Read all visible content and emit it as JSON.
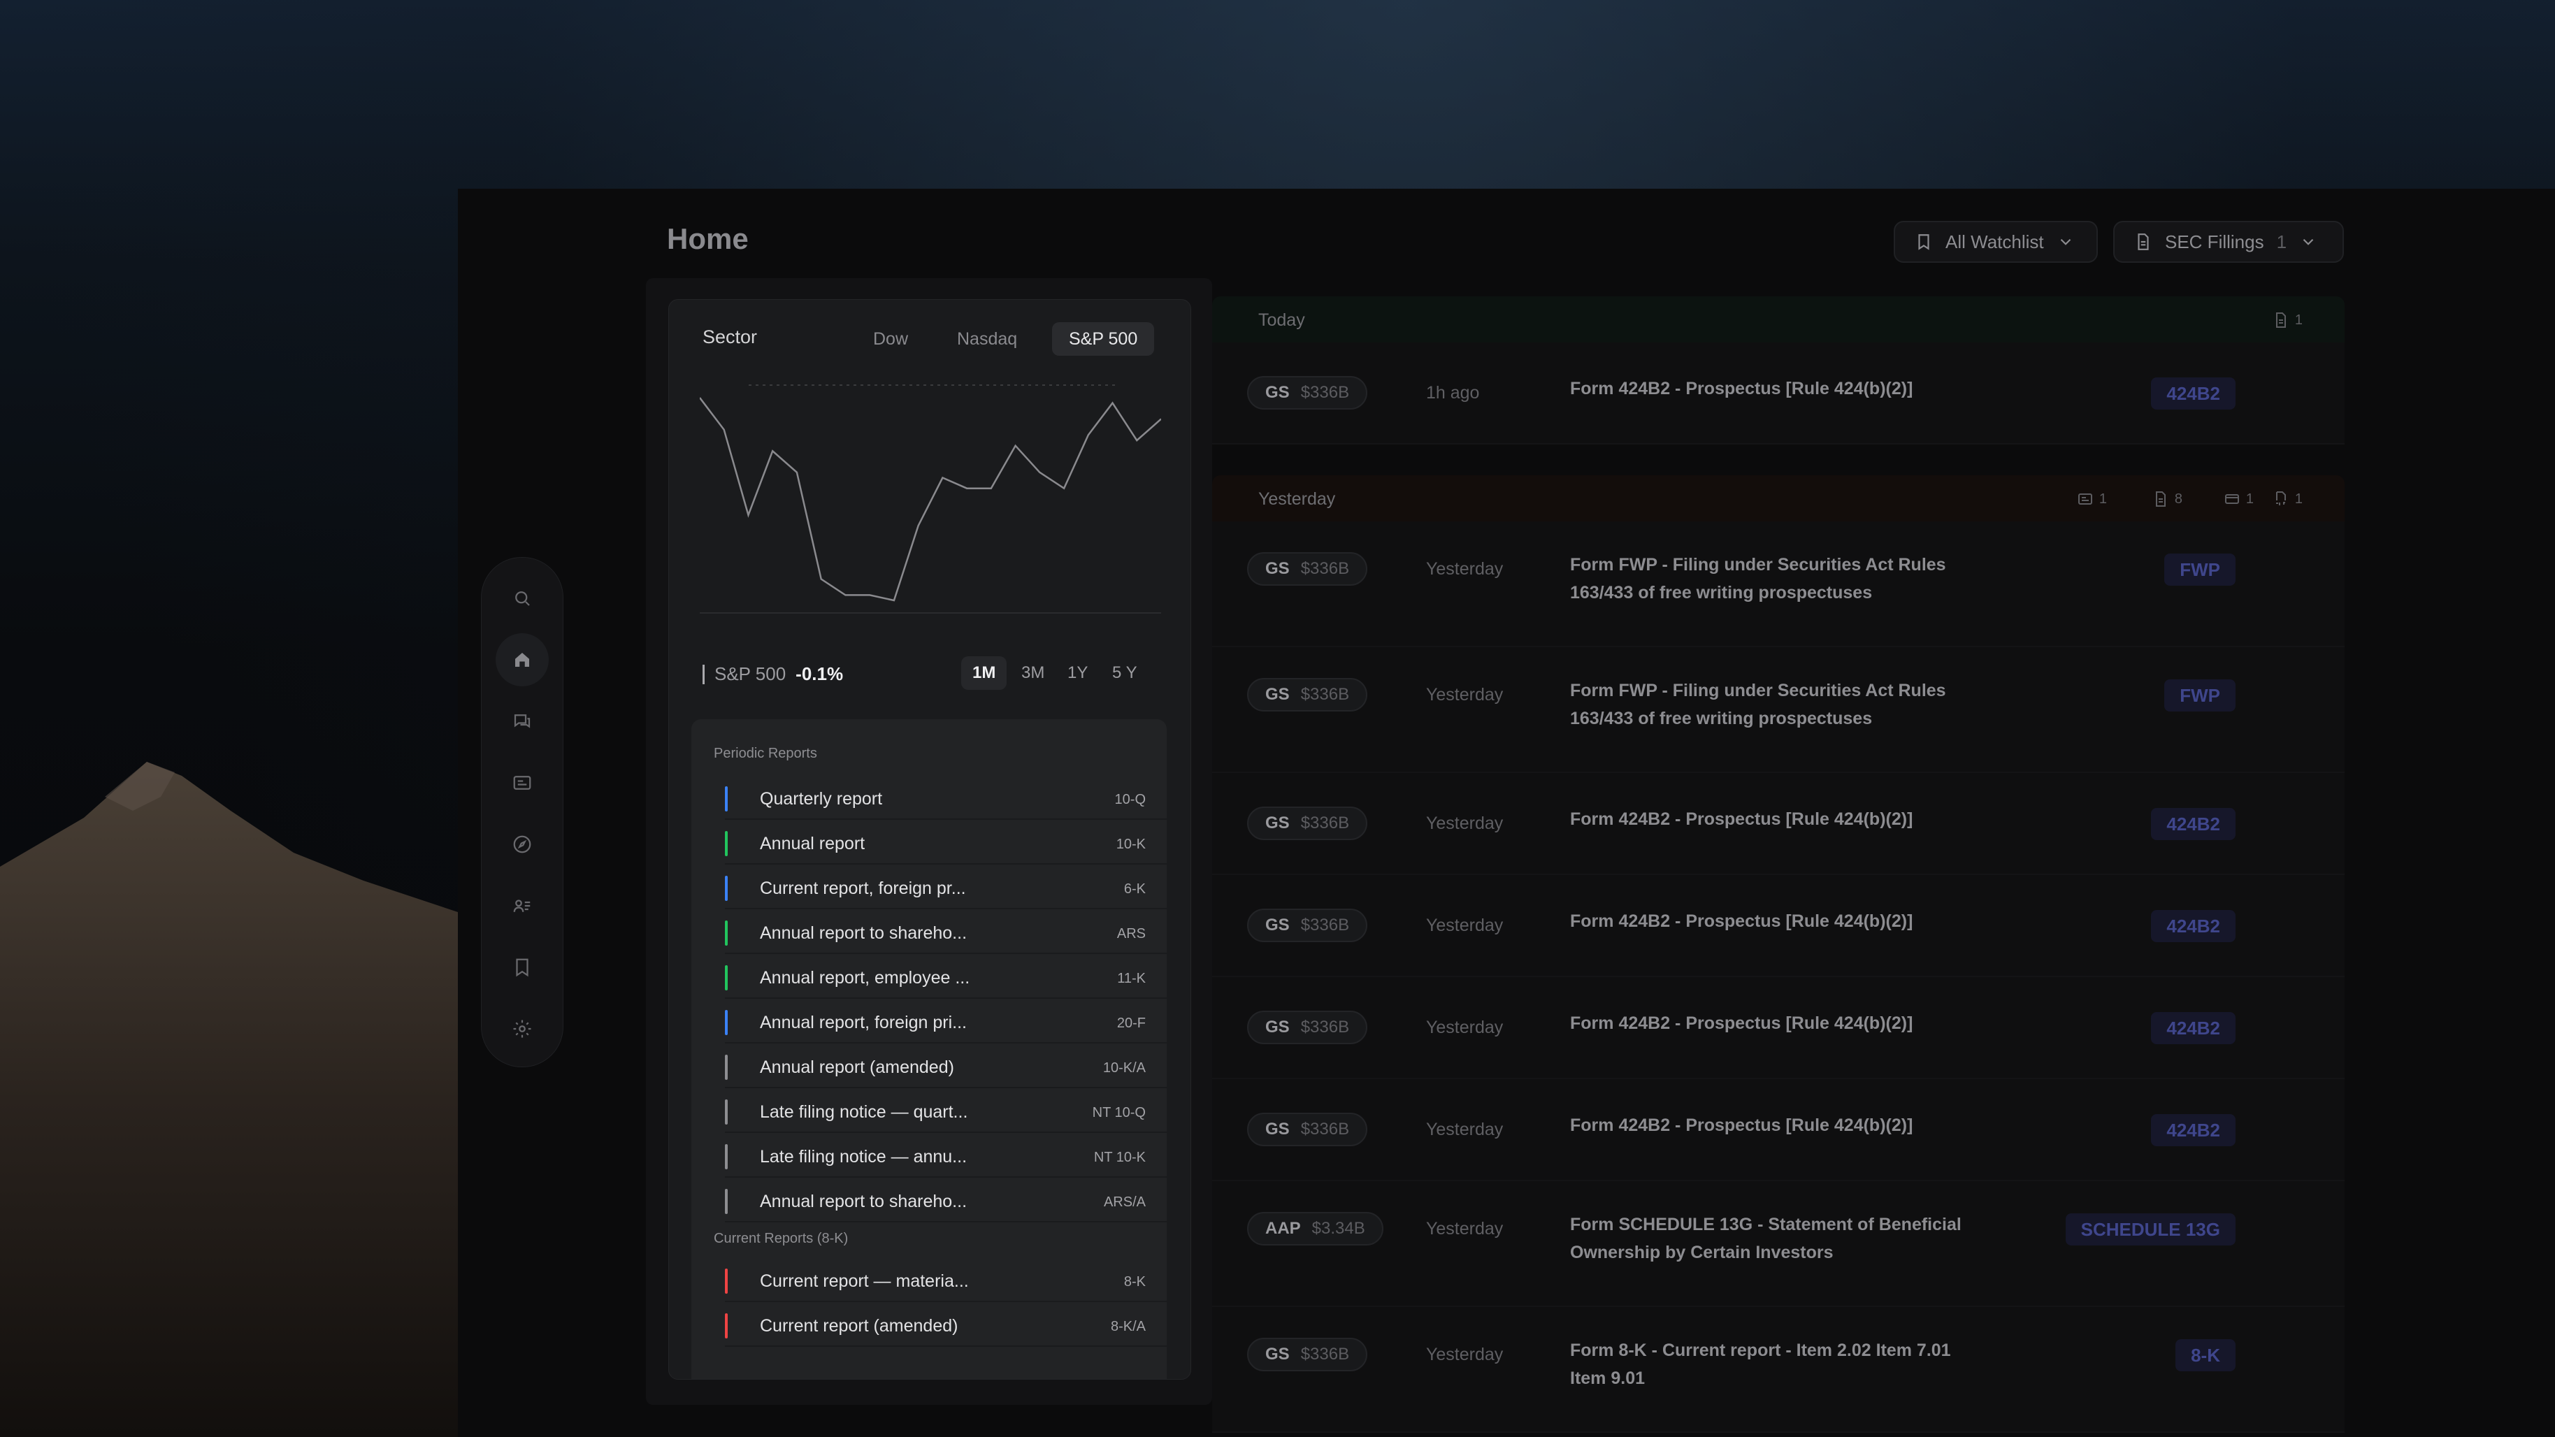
{
  "page": {
    "title": "Home"
  },
  "toolbar": {
    "watchlist_label": "All Watchlist",
    "filings_label": "SEC Fillings",
    "filings_count": "1"
  },
  "sidebar": {
    "icons": [
      "search-icon",
      "home-icon",
      "chat-icon",
      "news-icon",
      "compass-icon",
      "contacts-icon",
      "bookmark-icon",
      "settings-icon"
    ]
  },
  "market": {
    "title": "Sector",
    "tabs": [
      "Dow",
      "Nasdaq",
      "S&P 500"
    ],
    "active_tab": "S&P 500",
    "legend_label": "S&P 500",
    "change": "-0.1%",
    "ranges": [
      "1M",
      "3M",
      "1Y",
      "5 Y"
    ],
    "active_range": "1M"
  },
  "chart_data": {
    "type": "line",
    "title": "",
    "series": [
      {
        "values": [
          62,
          56,
          40,
          52,
          48,
          28,
          25,
          25,
          24,
          38,
          47,
          45,
          45,
          53,
          48,
          45,
          55,
          61,
          54,
          58
        ]
      }
    ],
    "grid": false,
    "legend": "bottom-left"
  },
  "reports": {
    "periodic_label": "Periodic Reports",
    "periodic": [
      {
        "name": "Quarterly report",
        "code": "10-Q",
        "color": "#3b82f6"
      },
      {
        "name": "Annual report",
        "code": "10-K",
        "color": "#22c55e"
      },
      {
        "name": "Current report, foreign pr...",
        "code": "6-K",
        "color": "#3b82f6"
      },
      {
        "name": "Annual report to shareho...",
        "code": "ARS",
        "color": "#22c55e"
      },
      {
        "name": "Annual report, employee ...",
        "code": "11-K",
        "color": "#22c55e"
      },
      {
        "name": "Annual report, foreign pri...",
        "code": "20-F",
        "color": "#3b82f6"
      },
      {
        "name": "Annual report (amended)",
        "code": "10-K/A",
        "color": "#8e8e92"
      },
      {
        "name": "Late filing notice — quart...",
        "code": "NT 10-Q",
        "color": "#8e8e92"
      },
      {
        "name": "Late filing notice — annu...",
        "code": "NT 10-K",
        "color": "#8e8e92"
      },
      {
        "name": "Annual report to shareho...",
        "code": "ARS/A",
        "color": "#8e8e92"
      }
    ],
    "current_label": "Current Reports (8-K)",
    "current": [
      {
        "name": "Current report — materia...",
        "code": "8-K",
        "color": "#ef4444"
      },
      {
        "name": "Current report (amended)",
        "code": "8-K/A",
        "color": "#ef4444"
      }
    ]
  },
  "feed": {
    "today": {
      "label": "Today",
      "doc_count": "1"
    },
    "yesterday": {
      "label": "Yesterday",
      "counts": [
        "1",
        "8",
        "1",
        "1"
      ]
    },
    "rows": [
      {
        "ticker": "GS",
        "mcap": "$336B",
        "when": "1h ago",
        "desc": "Form 424B2 - Prospectus [Rule 424(b)(2)]",
        "badge": "424B2"
      },
      {
        "ticker": "GS",
        "mcap": "$336B",
        "when": "Yesterday",
        "desc": "Form FWP - Filing under Securities Act Rules 163/433 of free writing prospectuses",
        "badge": "FWP"
      },
      {
        "ticker": "GS",
        "mcap": "$336B",
        "when": "Yesterday",
        "desc": "Form FWP - Filing under Securities Act Rules 163/433 of free writing prospectuses",
        "badge": "FWP"
      },
      {
        "ticker": "GS",
        "mcap": "$336B",
        "when": "Yesterday",
        "desc": "Form 424B2 - Prospectus [Rule 424(b)(2)]",
        "badge": "424B2"
      },
      {
        "ticker": "GS",
        "mcap": "$336B",
        "when": "Yesterday",
        "desc": "Form 424B2 - Prospectus [Rule 424(b)(2)]",
        "badge": "424B2"
      },
      {
        "ticker": "GS",
        "mcap": "$336B",
        "when": "Yesterday",
        "desc": "Form 424B2 - Prospectus [Rule 424(b)(2)]",
        "badge": "424B2"
      },
      {
        "ticker": "GS",
        "mcap": "$336B",
        "when": "Yesterday",
        "desc": "Form 424B2 - Prospectus [Rule 424(b)(2)]",
        "badge": "424B2"
      },
      {
        "ticker": "AAP",
        "mcap": "$3.34B",
        "when": "Yesterday",
        "desc": "Form SCHEDULE 13G - Statement of Beneficial Ownership by Certain Investors",
        "badge": "SCHEDULE 13G"
      },
      {
        "ticker": "GS",
        "mcap": "$336B",
        "when": "Yesterday",
        "desc": "Form 8-K - Current report - Item 2.02 Item 7.01 Item 9.01",
        "badge": "8-K"
      }
    ]
  }
}
